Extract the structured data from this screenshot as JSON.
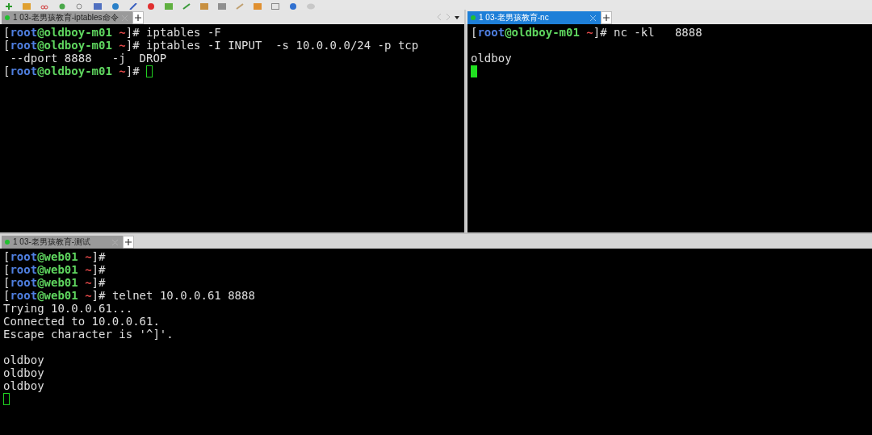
{
  "panes": [
    {
      "tab": {
        "label": "1 03-老男孩教育-iptables命令",
        "selected": false,
        "connected": true
      },
      "nav": true,
      "lines": [
        {
          "kind": "text",
          "segments": [
            {
              "kind": "plain",
              "text": "["
            },
            {
              "kind": "user",
              "text": "root"
            },
            {
              "kind": "host",
              "text": "@oldboy-m01 "
            },
            {
              "kind": "dir",
              "text": "~"
            },
            {
              "kind": "plain",
              "text": "]# iptables -F"
            }
          ]
        },
        {
          "kind": "text",
          "segments": [
            {
              "kind": "plain",
              "text": "["
            },
            {
              "kind": "user",
              "text": "root"
            },
            {
              "kind": "host",
              "text": "@oldboy-m01 "
            },
            {
              "kind": "dir",
              "text": "~"
            },
            {
              "kind": "plain",
              "text": "]# iptables -I INPUT  -s 10.0.0.0/24 -p tcp"
            }
          ]
        },
        {
          "kind": "text",
          "segments": [
            {
              "kind": "plain",
              "text": " --dport 8888   -j  DROP"
            }
          ]
        },
        {
          "kind": "text",
          "cursor": true,
          "cursor_filled": false,
          "segments": [
            {
              "kind": "plain",
              "text": "["
            },
            {
              "kind": "user",
              "text": "root"
            },
            {
              "kind": "host",
              "text": "@oldboy-m01 "
            },
            {
              "kind": "dir",
              "text": "~"
            },
            {
              "kind": "plain",
              "text": "]# "
            }
          ]
        }
      ]
    },
    {
      "tab": {
        "label": "1 03-老男孩教育-nc",
        "selected": true,
        "connected": true
      },
      "lines": [
        {
          "kind": "text",
          "segments": [
            {
              "kind": "plain",
              "text": "["
            },
            {
              "kind": "user",
              "text": "root"
            },
            {
              "kind": "host",
              "text": "@oldboy-m01 "
            },
            {
              "kind": "dir",
              "text": "~"
            },
            {
              "kind": "plain",
              "text": "]# nc -kl   8888"
            }
          ]
        },
        {
          "kind": "blank"
        },
        {
          "kind": "text",
          "segments": [
            {
              "kind": "plain",
              "text": "oldboy"
            }
          ]
        },
        {
          "kind": "blank",
          "cursor": true,
          "cursor_filled": true
        }
      ]
    },
    {
      "tab": {
        "label": "1 03-老男孩教育-测试",
        "selected": false,
        "connected": true
      },
      "lines": [
        {
          "kind": "text",
          "segments": [
            {
              "kind": "plain",
              "text": "["
            },
            {
              "kind": "user",
              "text": "root"
            },
            {
              "kind": "host",
              "text": "@web01 "
            },
            {
              "kind": "dir",
              "text": "~"
            },
            {
              "kind": "plain",
              "text": "]#"
            }
          ]
        },
        {
          "kind": "text",
          "segments": [
            {
              "kind": "plain",
              "text": "["
            },
            {
              "kind": "user",
              "text": "root"
            },
            {
              "kind": "host",
              "text": "@web01 "
            },
            {
              "kind": "dir",
              "text": "~"
            },
            {
              "kind": "plain",
              "text": "]#"
            }
          ]
        },
        {
          "kind": "text",
          "segments": [
            {
              "kind": "plain",
              "text": "["
            },
            {
              "kind": "user",
              "text": "root"
            },
            {
              "kind": "host",
              "text": "@web01 "
            },
            {
              "kind": "dir",
              "text": "~"
            },
            {
              "kind": "plain",
              "text": "]#"
            }
          ]
        },
        {
          "kind": "text",
          "segments": [
            {
              "kind": "plain",
              "text": "["
            },
            {
              "kind": "user",
              "text": "root"
            },
            {
              "kind": "host",
              "text": "@web01 "
            },
            {
              "kind": "dir",
              "text": "~"
            },
            {
              "kind": "plain",
              "text": "]# telnet 10.0.0.61 8888"
            }
          ]
        },
        {
          "kind": "text",
          "segments": [
            {
              "kind": "plain",
              "text": "Trying 10.0.0.61..."
            }
          ]
        },
        {
          "kind": "text",
          "segments": [
            {
              "kind": "plain",
              "text": "Connected to 10.0.0.61."
            }
          ]
        },
        {
          "kind": "text",
          "segments": [
            {
              "kind": "plain",
              "text": "Escape character is '^]'."
            }
          ]
        },
        {
          "kind": "blank"
        },
        {
          "kind": "text",
          "segments": [
            {
              "kind": "plain",
              "text": "oldboy"
            }
          ]
        },
        {
          "kind": "text",
          "segments": [
            {
              "kind": "plain",
              "text": "oldboy"
            }
          ]
        },
        {
          "kind": "text",
          "segments": [
            {
              "kind": "plain",
              "text": "oldboy"
            }
          ]
        },
        {
          "kind": "blank",
          "cursor": true,
          "cursor_filled": false
        }
      ]
    }
  ]
}
